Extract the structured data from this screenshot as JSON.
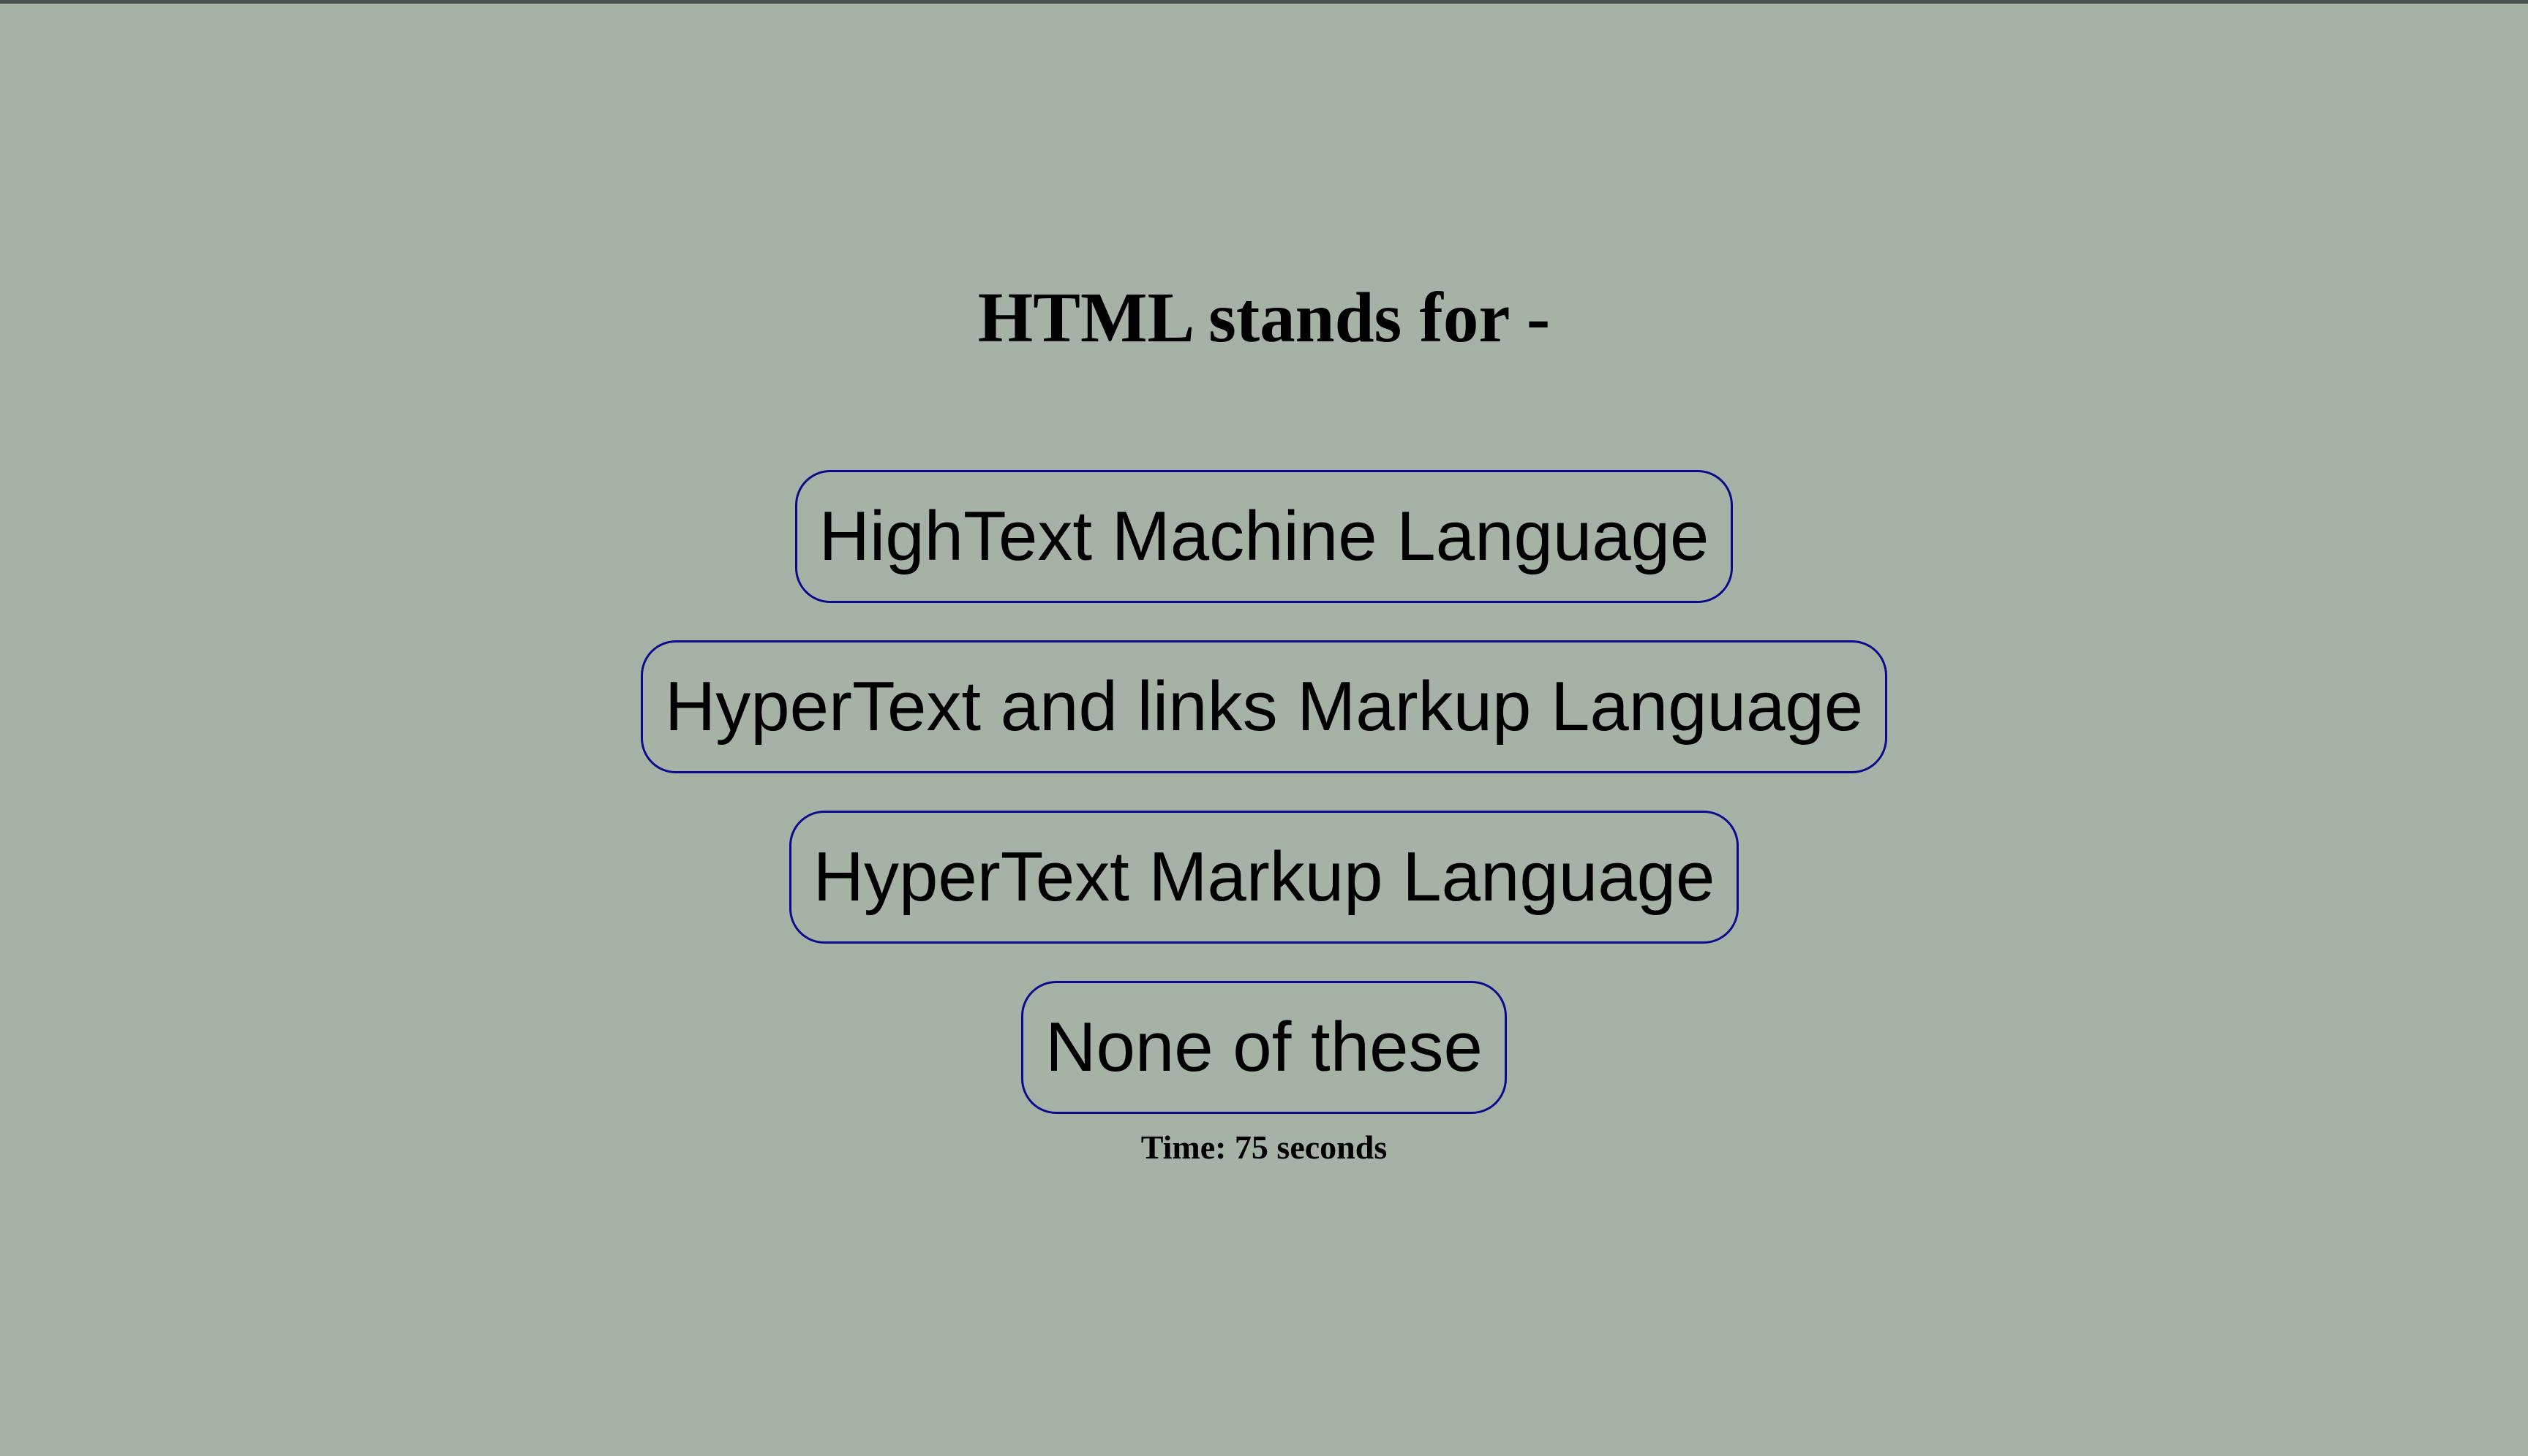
{
  "quiz": {
    "question": "HTML stands for -",
    "options": [
      "HighText Machine Language",
      "HyperText and links Markup Language",
      "HyperText Markup Language",
      "None of these"
    ],
    "timer": "Time: 75 seconds"
  },
  "colors": {
    "background": "#a7b2a7",
    "option_border": "#0a0a8c",
    "text": "#000000"
  }
}
